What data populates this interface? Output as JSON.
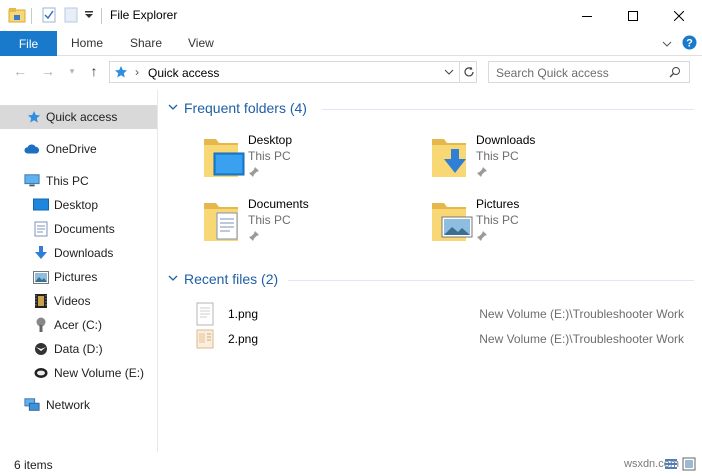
{
  "window": {
    "title": "File Explorer",
    "controls": [
      "minimize-icon",
      "maximize-icon",
      "close-icon"
    ]
  },
  "ribbon": {
    "tabs": [
      {
        "label": "File",
        "active": true
      },
      {
        "label": "Home"
      },
      {
        "label": "Share"
      },
      {
        "label": "View"
      }
    ],
    "help_icon": "help-icon",
    "accent": "#1979ca"
  },
  "address": {
    "location": "Quick access",
    "search_placeholder": "Search Quick access"
  },
  "sidebar": {
    "items": [
      {
        "label": "Quick access",
        "icon": "star-icon",
        "selected": true
      },
      {
        "label": "OneDrive",
        "icon": "cloud-icon"
      },
      {
        "label": "This PC",
        "icon": "computer-icon"
      },
      {
        "label": "Desktop",
        "icon": "desktop-icon"
      },
      {
        "label": "Documents",
        "icon": "documents-icon"
      },
      {
        "label": "Downloads",
        "icon": "download-icon"
      },
      {
        "label": "Pictures",
        "icon": "pictures-icon"
      },
      {
        "label": "Videos",
        "icon": "videos-icon"
      },
      {
        "label": "Acer (C:)",
        "icon": "drive-icon"
      },
      {
        "label": "Data (D:)",
        "icon": "drive-icon"
      },
      {
        "label": "New Volume (E:)",
        "icon": "drive-icon"
      },
      {
        "label": "Network",
        "icon": "network-icon"
      }
    ]
  },
  "main": {
    "frequent_header": "Frequent folders (4)",
    "frequent": [
      {
        "name": "Desktop",
        "location": "This PC",
        "icon": "desktop-folder-icon"
      },
      {
        "name": "Downloads",
        "location": "This PC",
        "icon": "downloads-folder-icon"
      },
      {
        "name": "Documents",
        "location": "This PC",
        "icon": "documents-folder-icon"
      },
      {
        "name": "Pictures",
        "location": "This PC",
        "icon": "pictures-folder-icon"
      }
    ],
    "recent_header": "Recent files (2)",
    "recent": [
      {
        "name": "1.png",
        "path": "New Volume (E:)\\Troubleshooter Work"
      },
      {
        "name": "2.png",
        "path": "New Volume (E:)\\Troubleshooter Work"
      }
    ]
  },
  "status": {
    "count": "6 items",
    "watermark": "wsxdn.com"
  },
  "colors": {
    "folder_yellow": "#f8d775",
    "folder_dark": "#e6b84c",
    "header_blue": "#1f5fa5",
    "selection": "#d9d9d9"
  }
}
